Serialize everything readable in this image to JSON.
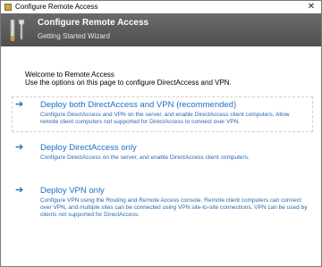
{
  "window": {
    "title": "Configure Remote Access",
    "close_glyph": "✕"
  },
  "header": {
    "title": "Configure Remote Access",
    "subtitle": "Getting Started Wizard",
    "icon": "wizard-tools-icon"
  },
  "intro": {
    "line1": "Welcome to Remote Access",
    "line2": "Use the options on this page to configure DirectAccess and VPN."
  },
  "options": [
    {
      "title": "Deploy both DirectAccess and VPN (recommended)",
      "description": "Configure DirectAccess and VPN on the server, and enable DirectAccess client computers. Allow remote client computers not supported for DirectAccess to connect over VPN."
    },
    {
      "title": "Deploy DirectAccess only",
      "description": "Configure DirectAccess on the server, and enable DirectAccess client computers."
    },
    {
      "title": "Deploy VPN only",
      "description": "Configure VPN using the Routing and Remote Access console. Remote client computers can connect over VPN, and multiple sites can be connected using VPN site-to-site connections. VPN can be used by clients not supported for DirectAccess."
    }
  ],
  "colors": {
    "link": "#1a6fc4",
    "header_bg": "#5a5a5a"
  }
}
